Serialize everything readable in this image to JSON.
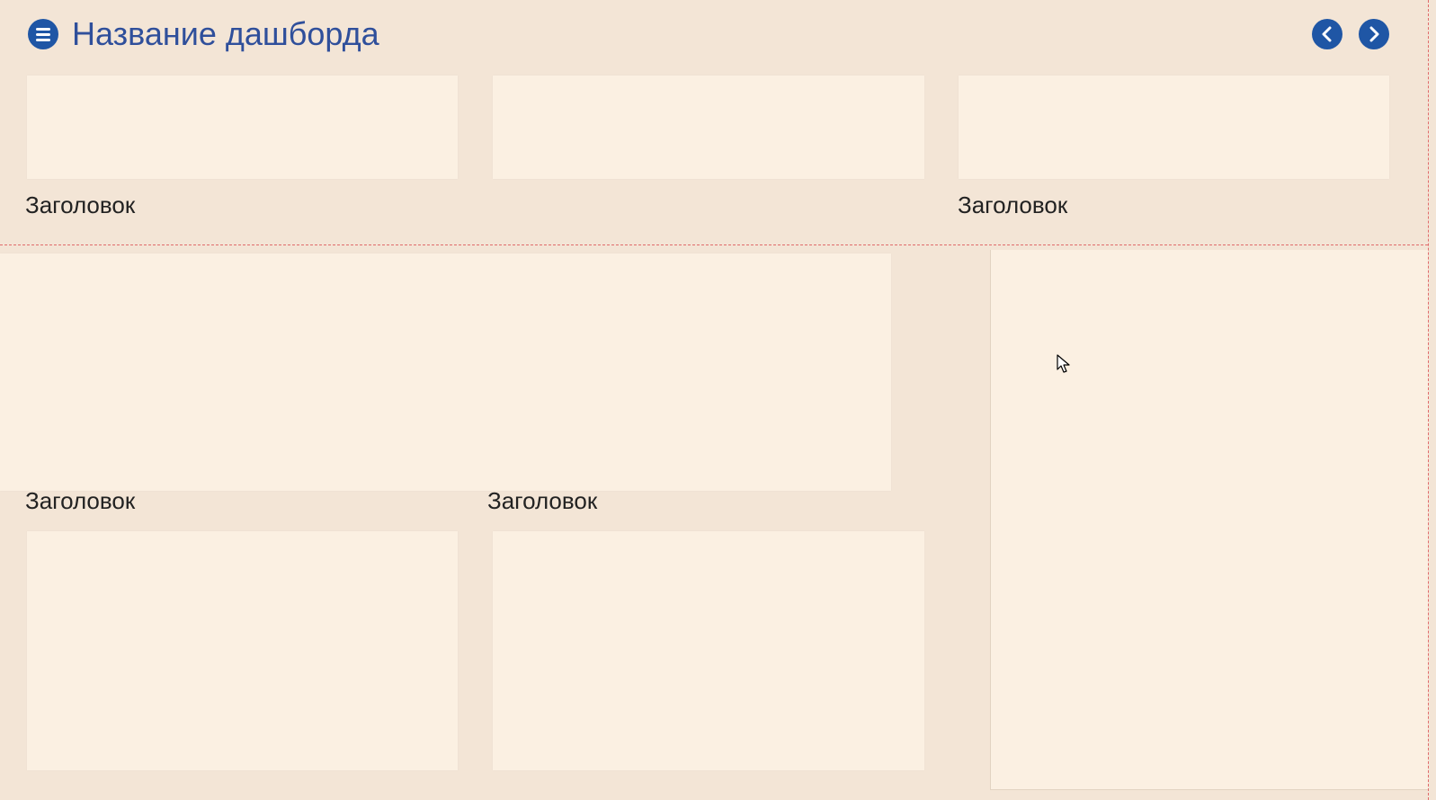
{
  "header": {
    "title": "Название дашборда",
    "menu_icon": "hamburger-menu-icon",
    "prev_icon": "chevron-left-icon",
    "next_icon": "chevron-right-icon"
  },
  "cards": {
    "top_left_title": "Заголовок",
    "top_right_title": "Заголовок",
    "middle_left_title": "Заголовок",
    "middle_center_title": "Заголовок"
  },
  "colors": {
    "background": "#f3e5d6",
    "card": "#fbf0e2",
    "accent": "#1f56a5",
    "title": "#2f4f9b",
    "guide_line": "#e06b6b"
  }
}
